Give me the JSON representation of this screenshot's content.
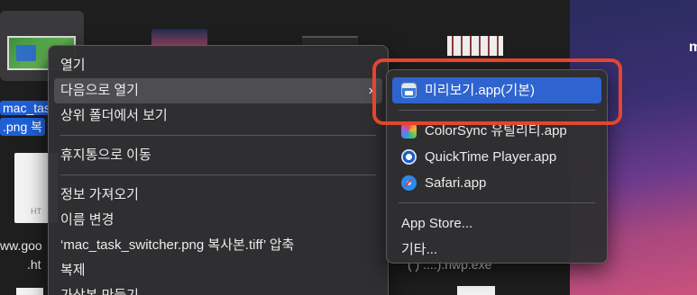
{
  "finder": {
    "selected_file_label_line1": "mac_tas",
    "selected_file_label_line2": ".png 복",
    "doc_thumb_label": "HT",
    "file_label_line1": "ww.goo",
    "file_label_line2": ".ht",
    "partial_file_label": "(  )     ....).hwp.exe"
  },
  "wallpaper": {
    "partial_text": "m"
  },
  "context_menu": {
    "items": [
      {
        "label": "열기"
      },
      {
        "label": "다음으로 열기",
        "chevron": "›"
      },
      {
        "label": "상위 폴더에서 보기"
      },
      {
        "label": "휴지통으로 이동"
      },
      {
        "label": "정보 가져오기"
      },
      {
        "label": "이름 변경"
      },
      {
        "label": "‘mac_task_switcher.png 복사본.tiff’ 압축"
      },
      {
        "label": "복제"
      },
      {
        "label": "가상본 만들기"
      }
    ]
  },
  "open_with_submenu": {
    "apps": [
      {
        "label": "미리보기.app(기본)",
        "icon": "preview-icon",
        "selected": true
      },
      {
        "label": "ColorSync 유틸리티.app",
        "icon": "colorsync-icon"
      },
      {
        "label": "QuickTime Player.app",
        "icon": "quicktime-icon"
      },
      {
        "label": "Safari.app",
        "icon": "safari-icon"
      }
    ],
    "extra": [
      {
        "label": "App Store..."
      },
      {
        "label": "기타..."
      }
    ]
  },
  "colors": {
    "selection": "#2f64d0",
    "highlight_annotation": "#e5452e"
  }
}
